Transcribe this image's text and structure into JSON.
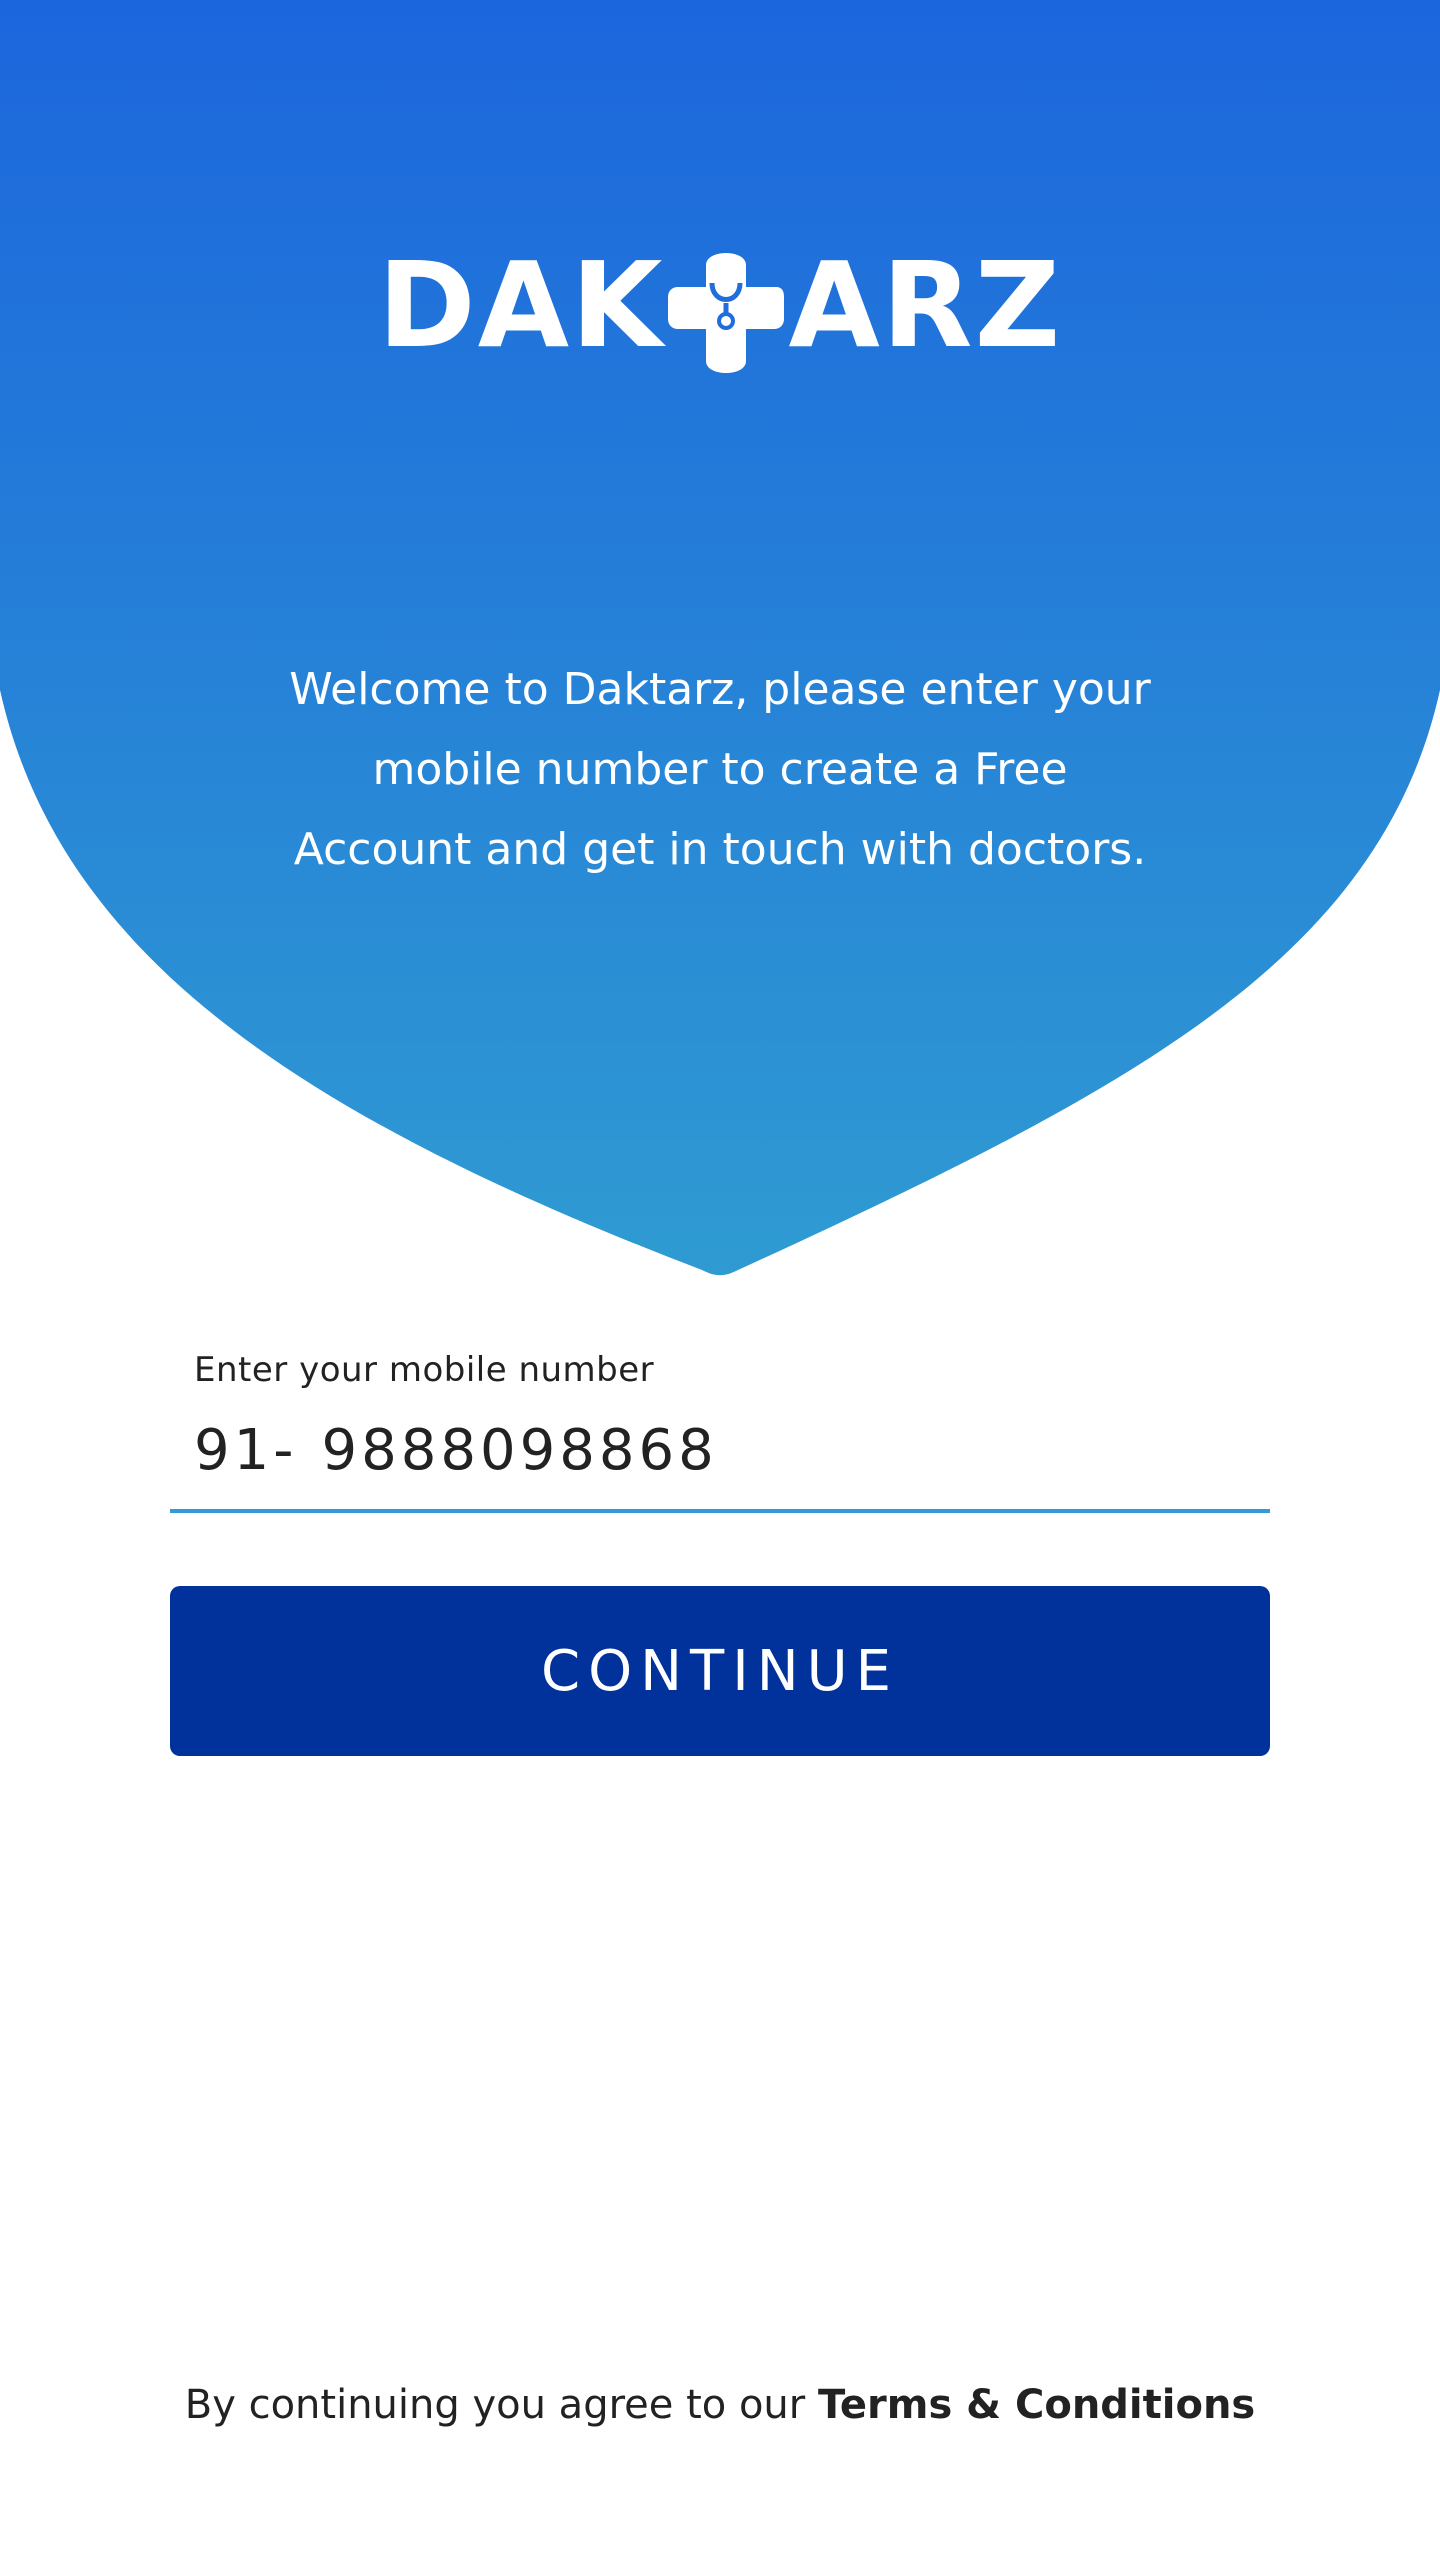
{
  "brand": {
    "logo_left": "DAK",
    "logo_right": "ARZ",
    "logo_icon": "medical-cross-stethoscope-icon",
    "gradient_top": "#1c66dd",
    "gradient_bottom": "#2f9bd2"
  },
  "welcome": {
    "line1": "Welcome to Daktarz, please enter your",
    "line2": "mobile number to create a Free",
    "line3": "Account and get in touch with doctors."
  },
  "phone_field": {
    "label": "Enter your mobile number",
    "country_code": "91-",
    "value": "9888098868",
    "underline_color": "#3598d8"
  },
  "continue_button": {
    "label": "CONTINUE",
    "color": "#01329b"
  },
  "footer": {
    "prefix": "By continuing you agree to our ",
    "link": "Terms & Conditions"
  }
}
